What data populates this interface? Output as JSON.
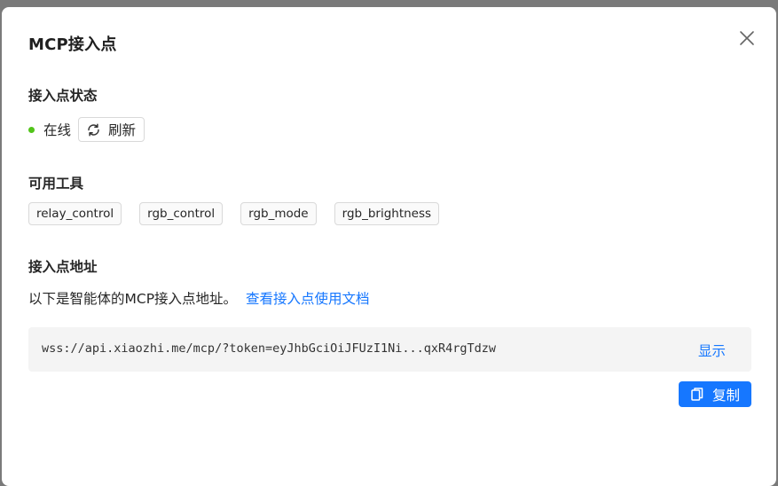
{
  "dialog": {
    "title": "MCP接入点",
    "close_icon": "close-icon"
  },
  "status_section": {
    "title": "接入点状态",
    "status_text": "在线",
    "status_color": "#52c41a",
    "refresh_label": "刷新",
    "refresh_icon": "refresh-icon"
  },
  "tools_section": {
    "title": "可用工具",
    "tools": [
      "relay_control",
      "rgb_control",
      "rgb_mode",
      "rgb_brightness"
    ]
  },
  "endpoint_section": {
    "title": "接入点地址",
    "description": "以下是智能体的MCP接入点地址。",
    "doc_link": "查看接入点使用文档",
    "url": "wss://api.xiaozhi.me/mcp/?token=eyJhbGciOiJFUzI1Ni...qxR4rgTdzw",
    "show_label": "显示",
    "copy_label": "复制",
    "copy_icon": "copy-icon"
  },
  "colors": {
    "accent": "#1677ff",
    "overlay": "#7a7a7a"
  }
}
